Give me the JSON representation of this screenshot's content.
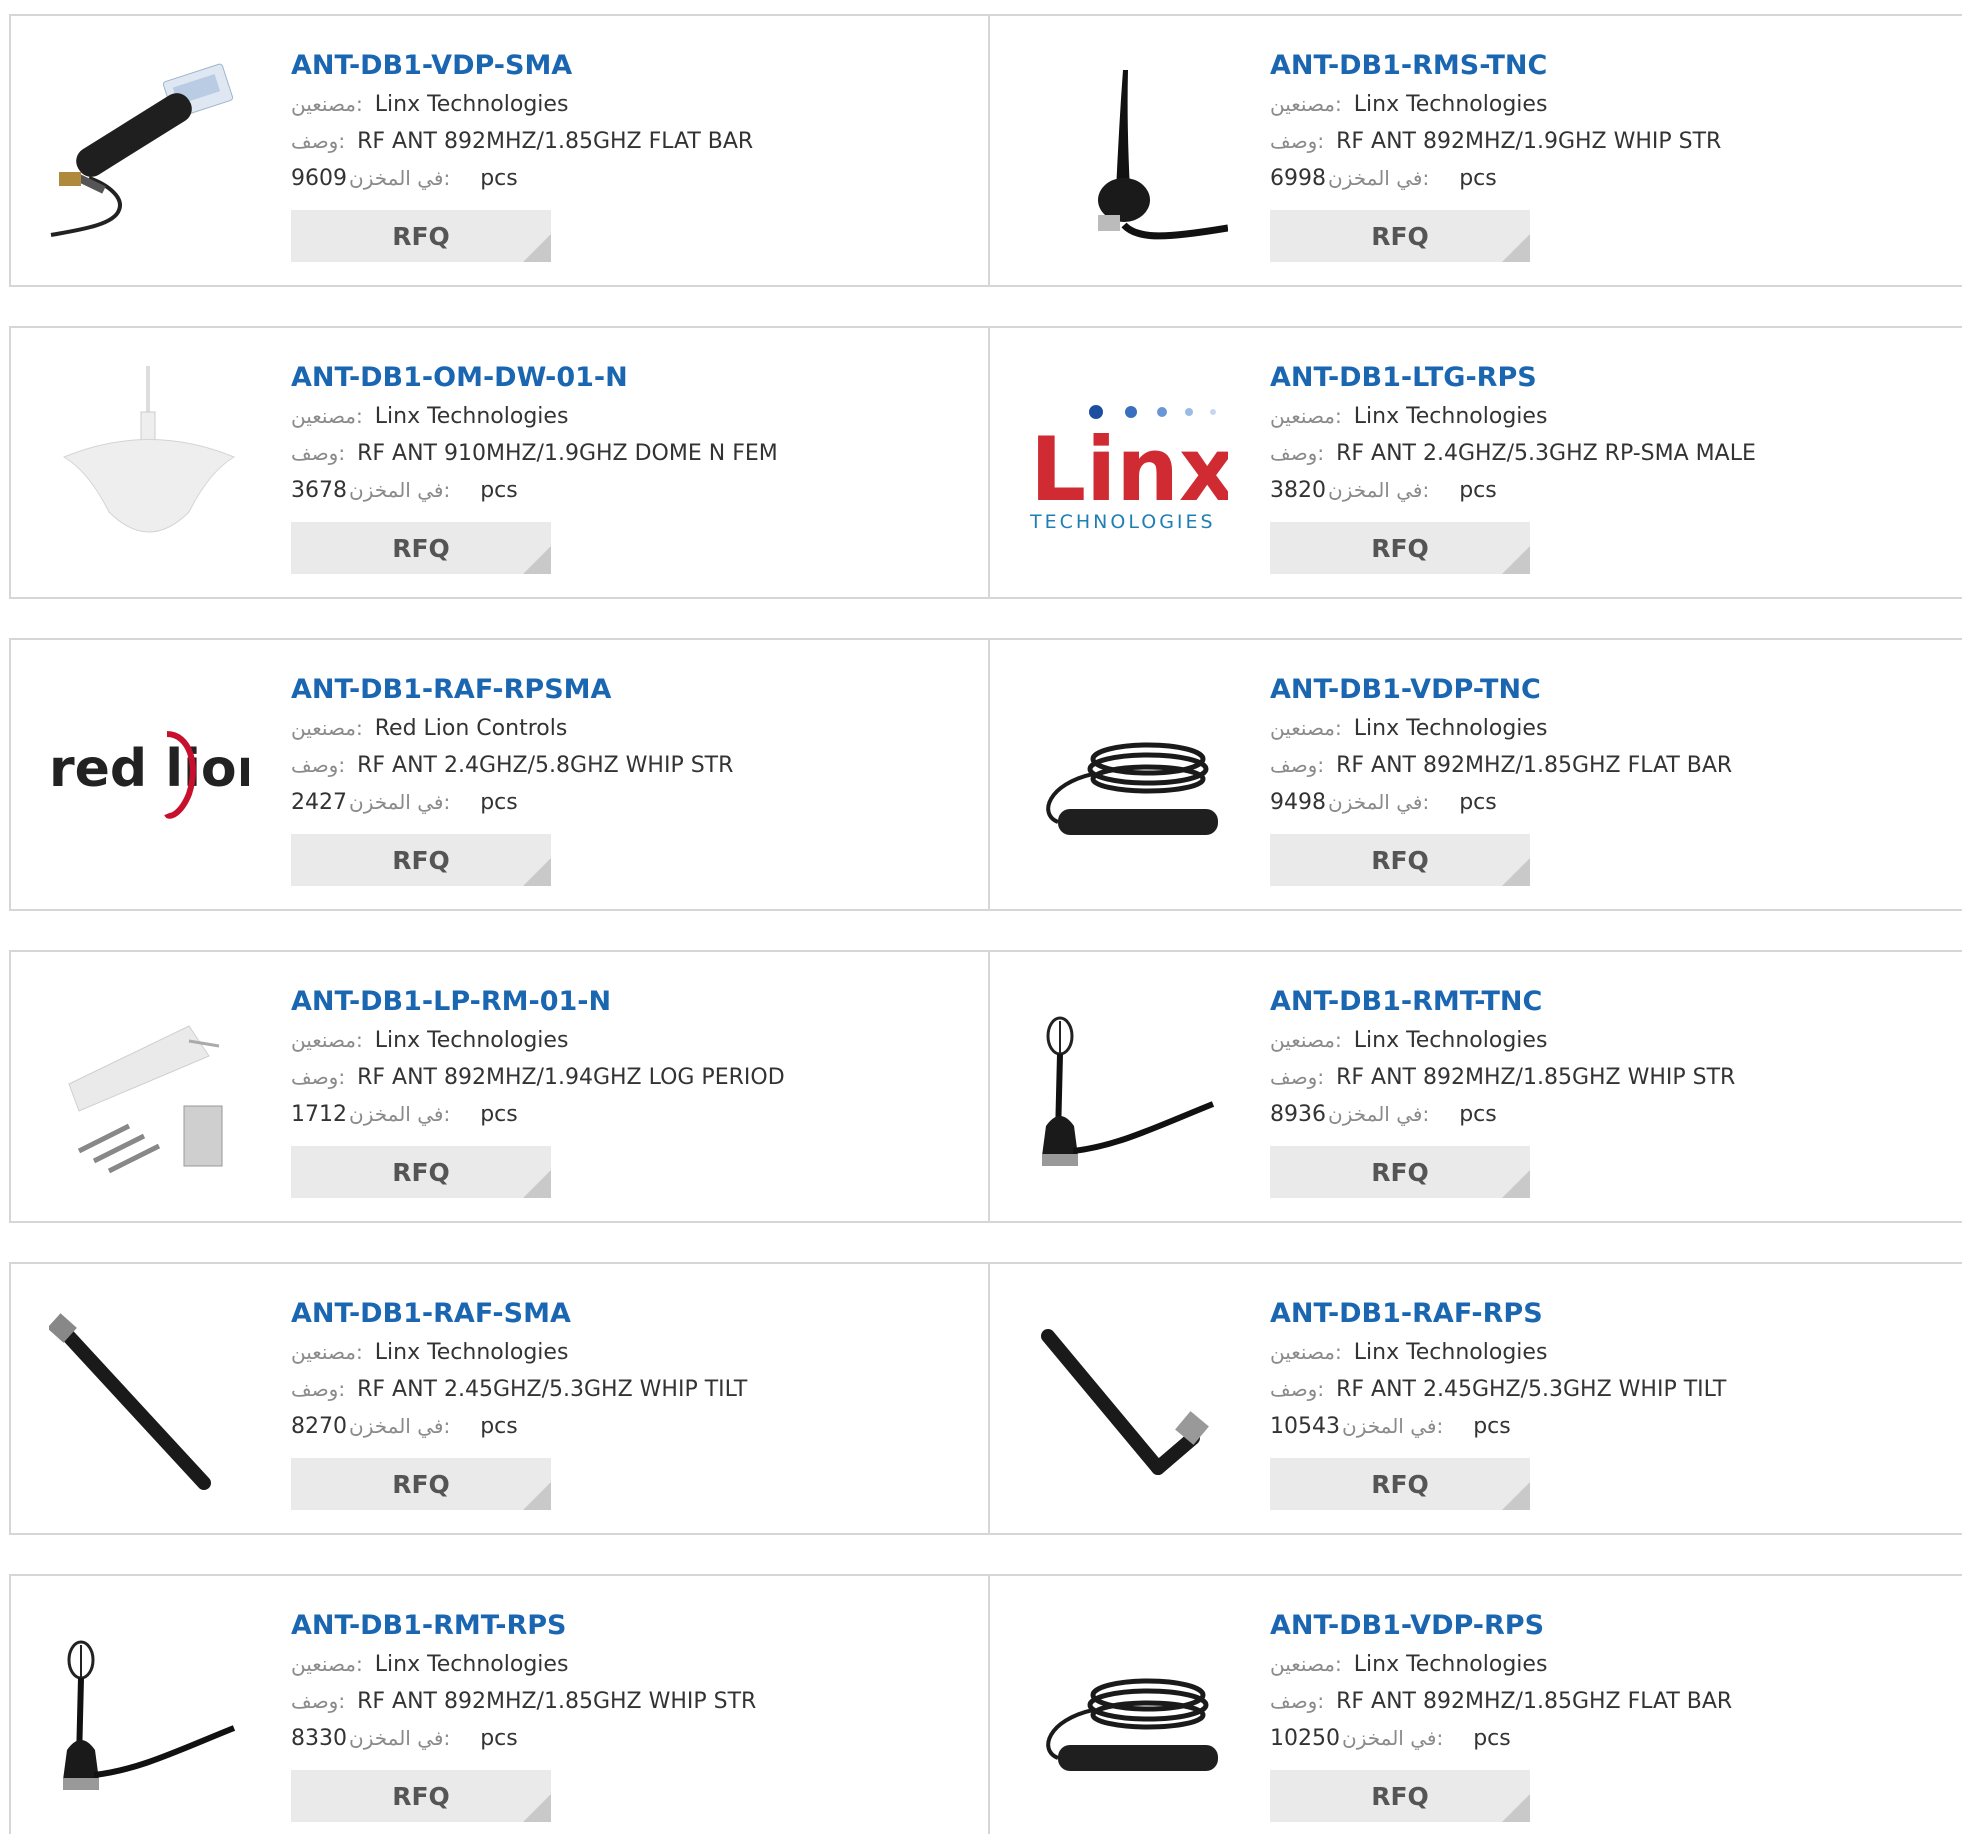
{
  "labels": {
    "manufacturer": "مصنعين:",
    "description": "وصف:",
    "in_stock": "في المخزن:",
    "unit": "pcs",
    "rfq": "RFQ"
  },
  "rows": [
    {
      "cards": [
        {
          "part": "ANT-DB1-VDP-SMA",
          "manufacturer": "Linx Technologies",
          "description": "RF ANT 892MHZ/1.85GHZ FLAT BAR",
          "stock": "9609",
          "image": "flat-bar-antenna-with-adhesive"
        },
        {
          "part": "ANT-DB1-RMS-TNC",
          "manufacturer": "Linx Technologies",
          "description": "RF ANT 892MHZ/1.9GHZ WHIP STR",
          "stock": "6998",
          "image": "magnetic-mount-whip-antenna"
        }
      ]
    },
    {
      "cards": [
        {
          "part": "ANT-DB1-OM-DW-01-N",
          "manufacturer": "Linx Technologies",
          "description": "RF ANT 910MHZ/1.9GHZ DOME N FEM",
          "stock": "3678",
          "image": "dome-antenna"
        },
        {
          "part": "ANT-DB1-LTG-RPS",
          "manufacturer": "Linx Technologies",
          "description": "RF ANT 2.4GHZ/5.3GHZ RP-SMA MALE",
          "stock": "3820",
          "image": "linx-technologies-logo",
          "logo_text": "Linx",
          "logo_sub": "TECHNOLOGIES"
        }
      ]
    },
    {
      "cards": [
        {
          "part": "ANT-DB1-RAF-RPSMA",
          "manufacturer": "Red Lion Controls",
          "description": "RF ANT 2.4GHZ/5.8GHZ WHIP STR",
          "stock": "2427",
          "image": "red-lion-logo",
          "logo_text": "red lion"
        },
        {
          "part": "ANT-DB1-VDP-TNC",
          "manufacturer": "Linx Technologies",
          "description": "RF ANT 892MHZ/1.85GHZ FLAT BAR",
          "stock": "9498",
          "image": "flat-bar-antenna-with-coiled-cable"
        }
      ]
    },
    {
      "cards": [
        {
          "part": "ANT-DB1-LP-RM-01-N",
          "manufacturer": "Linx Technologies",
          "description": "RF ANT 892MHZ/1.94GHZ LOG PERIOD",
          "stock": "1712",
          "image": "log-periodic-antenna"
        },
        {
          "part": "ANT-DB1-RMT-TNC",
          "manufacturer": "Linx Technologies",
          "description": "RF ANT 892MHZ/1.85GHZ WHIP STR",
          "stock": "8936",
          "image": "coil-whip-antenna"
        }
      ]
    },
    {
      "cards": [
        {
          "part": "ANT-DB1-RAF-SMA",
          "manufacturer": "Linx Technologies",
          "description": "RF ANT 2.45GHZ/5.3GHZ WHIP TILT",
          "stock": "8270",
          "image": "tilt-whip-antenna"
        },
        {
          "part": "ANT-DB1-RAF-RPS",
          "manufacturer": "Linx Technologies",
          "description": "RF ANT 2.45GHZ/5.3GHZ WHIP TILT",
          "stock": "10543",
          "image": "tilt-whip-antenna-bent"
        }
      ]
    },
    {
      "cards": [
        {
          "part": "ANT-DB1-RMT-RPS",
          "manufacturer": "Linx Technologies",
          "description": "RF ANT 892MHZ/1.85GHZ WHIP STR",
          "stock": "8330",
          "image": "coil-whip-antenna"
        },
        {
          "part": "ANT-DB1-VDP-RPS",
          "manufacturer": "Linx Technologies",
          "description": "RF ANT 892MHZ/1.85GHZ FLAT BAR",
          "stock": "10250",
          "image": "flat-bar-antenna-with-coiled-cable"
        }
      ]
    }
  ]
}
